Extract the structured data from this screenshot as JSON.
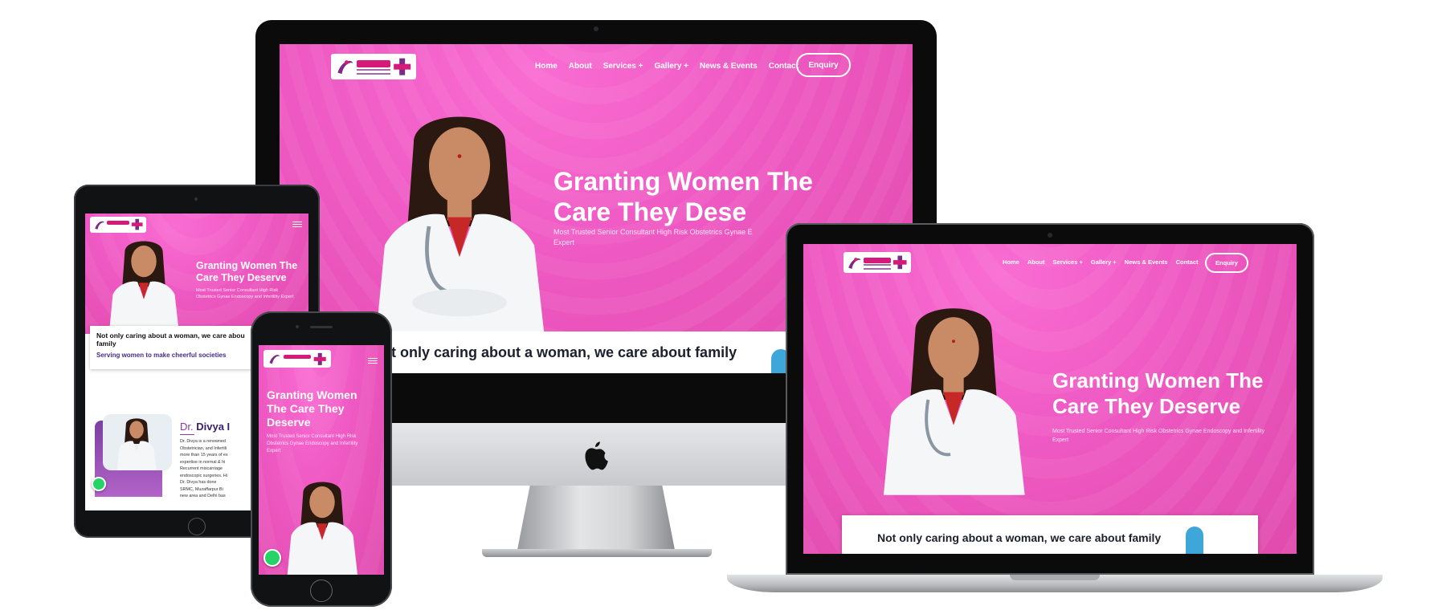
{
  "site": {
    "logo_label": "Dr. Divya Kumar logo",
    "nav": {
      "home": "Home",
      "about": "About",
      "services": "Services",
      "gallery": "Gallery",
      "news": "News & Events",
      "contact": "Contact",
      "plus": "+"
    },
    "enquiry": "Enquiry",
    "hero": {
      "headline": "Granting Women The Care They Deserve",
      "headline_line1": "Granting Women The",
      "headline_line2": "Care They Deserve",
      "desktop_line2_partial": "Care They Dese",
      "tablet_line1": "Granting Women The",
      "tablet_line2": "Care They Deserve",
      "phone_line1": "Granting Women",
      "phone_line2": "The Care They",
      "phone_line3": "Deserve",
      "subtext": "Most Trusted Senior Consultant High Risk Obstetrics Gynae Endoscopy and Infertility Expert",
      "desktop_sub_line1": "Most Trusted Senior Consultant High Risk Obstetrics Gynae E",
      "desktop_sub_line2": "Expert",
      "laptop_sub_line1": "Most Trusted Senior Consultant High Risk Obstetrics Gynae Endoscopy and Infertility",
      "laptop_sub_line2": "Expert",
      "tablet_sub_line1": "Most Trusted Senior Consultant High Risk",
      "tablet_sub_line2": "Obstetrics Gynae Endoscopy and Infertility Expert",
      "phone_sub_line1": "Most Trusted Senior Consultant High Risk",
      "phone_sub_line2": "Obstetrics Gynae Endoscopy and Infertility",
      "phone_sub_line3": "Expert"
    },
    "tagline": "Not only caring about a woman, we care about family",
    "tagline_desktop_partial": "ot only caring about a woman, we care about family",
    "tablet_tagline_line1": "Not only caring about a woman, we care abou",
    "tablet_tagline_line2": "family",
    "serving": "Serving women to make cheerful societies",
    "about": {
      "prefix": "Dr.",
      "name_partial": "Divya I",
      "body_lines": [
        "Dr. Divya is a renowned",
        "Obstetrician, and Infertili",
        "more than 15 years of ex",
        "expertise in normal & hi",
        "Recurrent miscarriage",
        "endoscopic surgeries. Hi",
        "Dr. Divya has done",
        "SRMC, Muzaffarpur Bi",
        "new area and Delhi bas"
      ]
    }
  },
  "colors": {
    "brand_pink": "#ec56bf",
    "accent_purple": "#5b2a86",
    "whatsapp": "#25d366"
  }
}
